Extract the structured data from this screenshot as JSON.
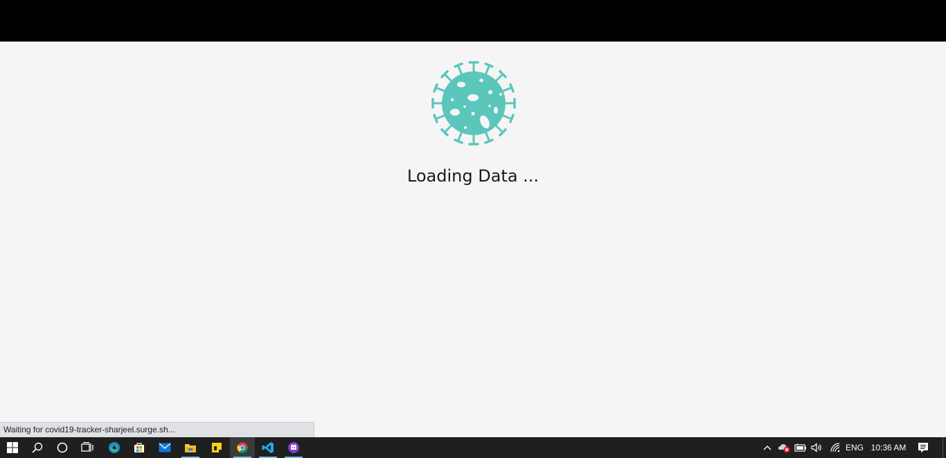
{
  "page": {
    "loading_text": "Loading Data ...",
    "accent_color": "#5bc6bc"
  },
  "browser": {
    "status_text": "Waiting for covid19-tracker-sharjeel.surge.sh..."
  },
  "taskbar": {
    "apps": [
      "start-icon",
      "search-icon",
      "cortana-icon",
      "task-view-icon",
      "edge-icon",
      "store-icon",
      "mail-icon",
      "file-explorer-icon",
      "sticky-notes-icon",
      "chrome-icon",
      "vscode-icon",
      "app-icon"
    ],
    "tray": {
      "language": "ENG",
      "time": "10:36 AM"
    }
  }
}
